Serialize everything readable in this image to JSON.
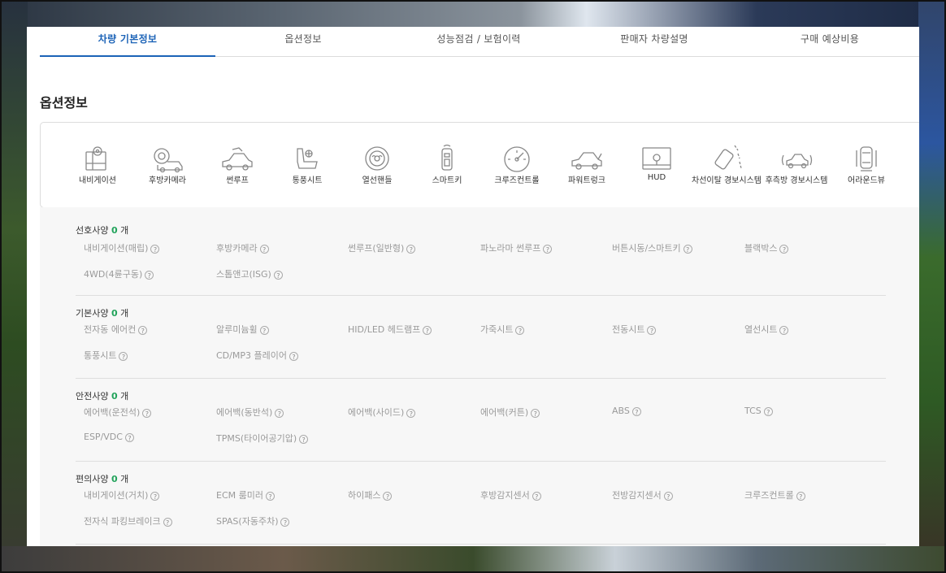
{
  "tabs": [
    {
      "label": "차량 기본정보",
      "active": true
    },
    {
      "label": "옵션정보"
    },
    {
      "label": "성능점검 / 보험이력"
    },
    {
      "label": "판매자 차량설명"
    },
    {
      "label": "구매 예상비용"
    }
  ],
  "section_title": "옵션정보",
  "icons": [
    {
      "label": "내비게이션",
      "icon": "navigation-icon"
    },
    {
      "label": "후방카메라",
      "icon": "rear-camera-icon"
    },
    {
      "label": "썬루프",
      "icon": "sunroof-icon"
    },
    {
      "label": "통풍시트",
      "icon": "ventilated-seat-icon"
    },
    {
      "label": "열선핸들",
      "icon": "heated-steering-icon"
    },
    {
      "label": "스마트키",
      "icon": "smart-key-icon"
    },
    {
      "label": "크루즈컨트롤",
      "icon": "cruise-control-icon"
    },
    {
      "label": "파워트렁크",
      "icon": "power-trunk-icon"
    },
    {
      "label": "HUD",
      "icon": "hud-icon"
    },
    {
      "label": "차선이탈 경보시스템",
      "icon": "lane-departure-icon"
    },
    {
      "label": "후측방 경보시스템",
      "icon": "blind-spot-icon"
    },
    {
      "label": "어라운드뷰",
      "icon": "around-view-icon"
    }
  ],
  "count_suffix": "개",
  "groups": [
    {
      "title": "선호사양",
      "count": "0",
      "options": [
        "내비게이션(매립)",
        "후방카메라",
        "썬루프(일반형)",
        "파노라마 썬루프",
        "버튼시동/스마트키",
        "블랙박스",
        "4WD(4륜구동)",
        "스톱앤고(ISG)"
      ]
    },
    {
      "title": "기본사양",
      "count": "0",
      "options": [
        "전자동 에어컨",
        "알루미늄휠",
        "HID/LED 헤드램프",
        "가죽시트",
        "전동시트",
        "열선시트",
        "통풍시트",
        "CD/MP3 플레이어"
      ]
    },
    {
      "title": "안전사양",
      "count": "0",
      "options": [
        "에어백(운전석)",
        "에어백(동반석)",
        "에어백(사이드)",
        "에어백(커튼)",
        "ABS",
        "TCS",
        "ESP/VDC",
        "TPMS(타이어공기압)"
      ]
    },
    {
      "title": "편의사양",
      "count": "0",
      "options": [
        "내비게이션(거치)",
        "ECM 룸미러",
        "하이패스",
        "후방감지센서",
        "전방감지센서",
        "크루즈컨트롤",
        "전자식 파킹브레이크",
        "SPAS(자동주차)"
      ]
    }
  ],
  "help_glyph": "?"
}
